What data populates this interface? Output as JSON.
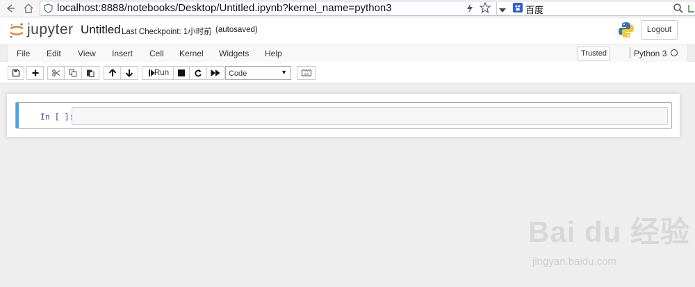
{
  "browser": {
    "url": "localhost:8888/notebooks/Desktop/Untitled.ipynb?kernel_name=python3",
    "search_engine": "百度"
  },
  "header": {
    "logo_text": "jupyter",
    "notebook_name": "Untitled",
    "checkpoint": "Last Checkpoint: 1小时前",
    "autosave_status": "(autosaved)",
    "logout_label": "Logout"
  },
  "menubar": {
    "items": [
      "File",
      "Edit",
      "View",
      "Insert",
      "Cell",
      "Kernel",
      "Widgets",
      "Help"
    ],
    "trusted_label": "Trusted",
    "kernel_name": "Python 3"
  },
  "toolbar": {
    "run_label": "Run",
    "cell_type": "Code"
  },
  "cell": {
    "prompt": "In [ ]:",
    "content": ""
  },
  "watermark": {
    "logo": "Bai du 经验",
    "sub": "jingyan.baidu.com"
  },
  "colors": {
    "jupyter_orange": "#f37726",
    "cell_selected_bar": "#42a5f5",
    "prompt_blue": "#303f9f"
  }
}
